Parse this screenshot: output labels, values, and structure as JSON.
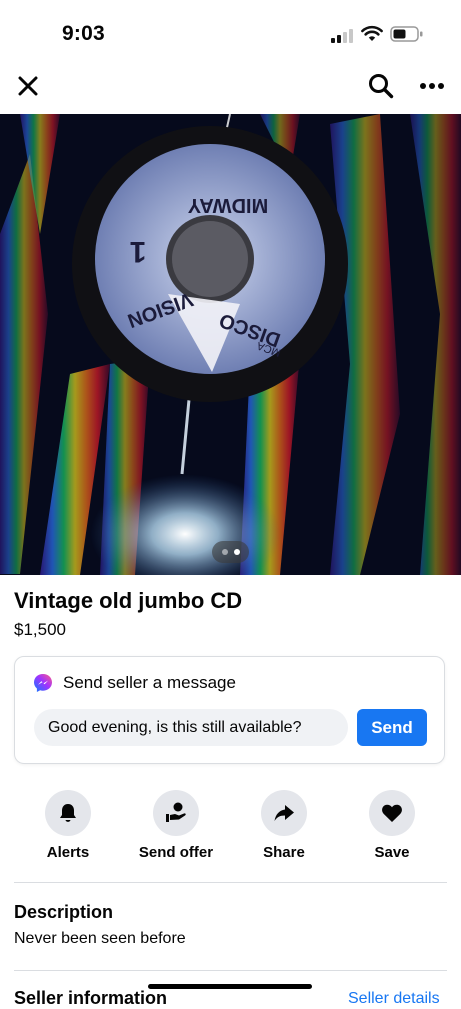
{
  "status_bar": {
    "time": "9:03"
  },
  "nav": {
    "close_icon": "close-icon",
    "search_icon": "search-icon",
    "more_icon": "more-icon"
  },
  "photo": {
    "disc_text": {
      "brand": "MIDWAY",
      "format_top": "DISCO",
      "format_bottom": "VISION",
      "side": "1",
      "maker": "MCA"
    },
    "pager": {
      "count": 2,
      "active": 2
    }
  },
  "listing": {
    "title": "Vintage old jumbo CD",
    "price": "$1,500"
  },
  "message": {
    "heading": "Send seller a message",
    "input_value": "Good evening, is this still available?",
    "send_label": "Send",
    "icon": "messenger-icon"
  },
  "actions": [
    {
      "label": "Alerts",
      "icon": "bell-icon"
    },
    {
      "label": "Send offer",
      "icon": "offer-icon"
    },
    {
      "label": "Share",
      "icon": "share-icon"
    },
    {
      "label": "Save",
      "icon": "heart-icon"
    }
  ],
  "description": {
    "heading": "Description",
    "text": "Never been seen before"
  },
  "seller": {
    "heading": "Seller information",
    "link": "Seller details"
  },
  "colors": {
    "accent": "#1877f2",
    "button_bg": "#e4e6eb",
    "input_bg": "#f0f2f5",
    "divider": "#dadde1"
  }
}
